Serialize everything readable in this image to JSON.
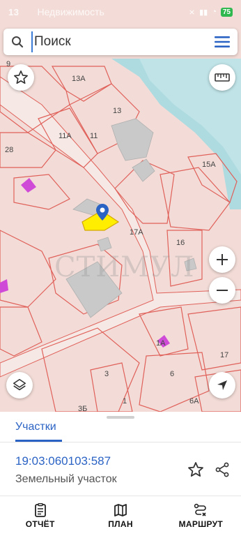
{
  "status_bar": {
    "time": "13",
    "battery": "75"
  },
  "search": {
    "placeholder": "Поиск",
    "overlay_text": "Недвижимость"
  },
  "map": {
    "watermark": "СТИМУЛ",
    "plot_labels": [
      "9",
      "13А",
      "13",
      "11А",
      "11",
      "28",
      "15А",
      "17А",
      "16",
      "1А",
      "17",
      "3",
      "6",
      "1",
      "6А",
      "3Б"
    ],
    "highlight_color": "#ffee00",
    "water_color": "#aedbe0",
    "plot_fill": "#f3dcd7",
    "border_color": "#e0605a"
  },
  "sheet": {
    "tab_label": "Участки",
    "parcel_id": "19:03:060103:587",
    "parcel_type": "Земельный участок"
  },
  "nav": [
    {
      "label": "ОТЧЁТ",
      "icon": "report-icon"
    },
    {
      "label": "ПЛАН",
      "icon": "map-plan-icon"
    },
    {
      "label": "МАРШРУТ",
      "icon": "route-icon"
    }
  ],
  "accent_color": "#2b63c4"
}
